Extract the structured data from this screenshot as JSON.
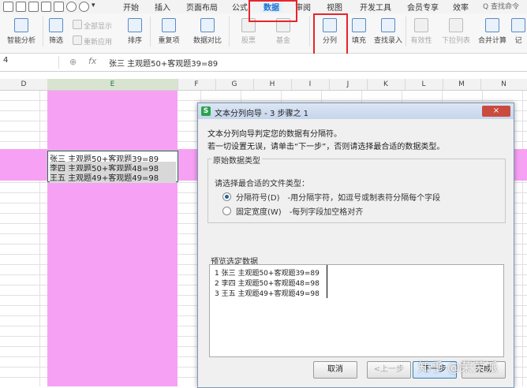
{
  "menubar": {
    "items": [
      "开始",
      "插入",
      "页面布局",
      "公式",
      "数据",
      "审阅",
      "视图",
      "开发工具",
      "会员专享",
      "效率"
    ],
    "search_placeholder": "Q 查找命令"
  },
  "ribbon": {
    "smart_analysis": "智能分析",
    "filter": "筛选",
    "show_all": "全部显示",
    "reapply": "重新应用",
    "sort": "排序",
    "duplicates": "重复项",
    "data_compare": "数据对比",
    "stocks": "股票",
    "fund": "基金",
    "text_to_columns": "分列",
    "fill": "填充",
    "find_entry": "查找录入",
    "validity": "有效性",
    "dropdown_list": "下拉列表",
    "consolidate": "合并计算",
    "more": "记"
  },
  "formula_bar": {
    "name_box": "4",
    "fx": "fx",
    "content": "张三 主观题50+客观题39=89"
  },
  "columns": [
    "D",
    "E",
    "F",
    "G",
    "H",
    "I",
    "J",
    "K",
    "L",
    "M",
    "N"
  ],
  "cells": [
    "张三  主观题50+客观题39=89",
    "李四  主观题50+客观题48=98",
    "王五  主观题49+客观题49=98"
  ],
  "dialog": {
    "title": "文本分列向导 - 3 步骤之 1",
    "icon": "S",
    "close_label": "×",
    "intro_line1": "文本分列向导判定您的数据有分隔符。",
    "intro_line2": "若一切设置无误，请单击“下一步”，否则请选择最合适的数据类型。",
    "group_title": "原始数据类型",
    "choose_label": "请选择最合适的文件类型：",
    "option_delimited": "分隔符号(D)",
    "option_delimited_desc": "-用分隔字符，如逗号或制表符分隔每个字段",
    "option_fixed": "固定宽度(W)",
    "option_fixed_desc": "-每列字段加空格对齐",
    "preview_label": "预览选定数据",
    "preview_lines": [
      "1  张三 主观题50+客观题39=89",
      "2  李四 主观题50+客观题48=98",
      "3  王五 主观题49+客观题49=98"
    ],
    "btn_cancel": "取消",
    "btn_back": "<上一步",
    "btn_next": "下一步",
    "btn_finish": "完成"
  },
  "watermark": "知乎 @荣荣派",
  "colors": {
    "highlight": "#f7a1f4",
    "redbox": "#e8242c",
    "accent": "#1d6fd0"
  }
}
